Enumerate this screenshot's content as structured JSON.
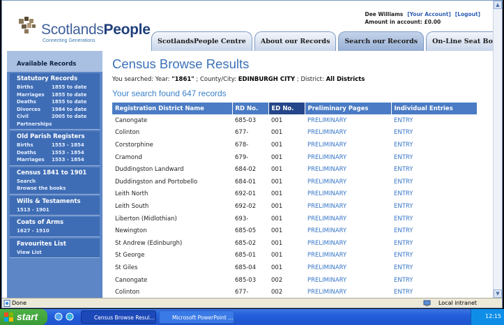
{
  "header": {
    "logo_word_regular": "Scotlands",
    "logo_word_bold": "People",
    "logo_tagline": "Connecting Generations",
    "user_name": "Dee Williams",
    "your_account_link": "[Your Account]",
    "logout_link": "[Logout]",
    "account_amount": "Amount in account: £0.00",
    "tabs": [
      {
        "label": "ScotlandsPeople Centre"
      },
      {
        "label": "About our Records"
      },
      {
        "label": "Search our Records"
      },
      {
        "label": "On-Line Seat Booking"
      }
    ]
  },
  "sidebar": {
    "available_records": "Available Records",
    "statutory": {
      "heading": "Statutory Records",
      "rows": [
        {
          "label": "Births",
          "years": "1855 to date"
        },
        {
          "label": "Marriages",
          "years": "1855 to date"
        },
        {
          "label": "Deaths",
          "years": "1855 to date"
        },
        {
          "label": "Divorces",
          "years": "1984 to date"
        },
        {
          "label": "Civil",
          "years": "2005 to date"
        }
      ],
      "partnerships": "Partnerships"
    },
    "opr": {
      "heading": "Old Parish Registers",
      "rows": [
        {
          "label": "Births",
          "years": "1553 - 1854"
        },
        {
          "label": "Deaths",
          "years": "1553 - 1854"
        },
        {
          "label": "Marriages",
          "years": "1553 - 1854"
        }
      ]
    },
    "census": {
      "heading": "Census 1841 to 1901",
      "search": "Search",
      "browse": "Browse the books"
    },
    "wills": {
      "heading": "Wills & Testaments",
      "years": "1513 - 1901"
    },
    "arms": {
      "heading": "Coats of Arms",
      "years": "1627 - 1910"
    },
    "favourites": {
      "heading": "Favourites List",
      "view": "View List"
    }
  },
  "main": {
    "title": "Census Browse Results",
    "searched_prefix": "You searched: Year:",
    "searched_year": "\"1861\"",
    "searched_county_label": "; County/City:",
    "searched_county": "EDINBURGH CITY",
    "searched_district_label": "; District:",
    "searched_district": "All Districts",
    "found": "Your search found 647 records",
    "columns": [
      "Registration District Name",
      "RD No.",
      "ED No.",
      "Preliminary Pages",
      "Individual Entries"
    ],
    "rows": [
      {
        "name": "Canongate",
        "rd": "685-03",
        "ed": "001",
        "pre": "PRELIMINARY",
        "entry": "ENTRY"
      },
      {
        "name": "Colinton",
        "rd": "677-",
        "ed": "001",
        "pre": "PRELIMINARY",
        "entry": "ENTRY"
      },
      {
        "name": "Corstorphine",
        "rd": "678-",
        "ed": "001",
        "pre": "PRELIMINARY",
        "entry": "ENTRY"
      },
      {
        "name": "Cramond",
        "rd": "679-",
        "ed": "001",
        "pre": "PRELIMINARY",
        "entry": "ENTRY"
      },
      {
        "name": "Duddingston Landward",
        "rd": "684-02",
        "ed": "001",
        "pre": "PRELIMINARY",
        "entry": "ENTRY"
      },
      {
        "name": "Duddingston and Portobello",
        "rd": "684-01",
        "ed": "001",
        "pre": "PRELIMINARY",
        "entry": "ENTRY"
      },
      {
        "name": "Leith North",
        "rd": "692-01",
        "ed": "001",
        "pre": "PRELIMINARY",
        "entry": "ENTRY"
      },
      {
        "name": "Leith South",
        "rd": "692-02",
        "ed": "001",
        "pre": "PRELIMINARY",
        "entry": "ENTRY"
      },
      {
        "name": "Liberton (Midlothian)",
        "rd": "693-",
        "ed": "001",
        "pre": "PRELIMINARY",
        "entry": "ENTRY"
      },
      {
        "name": "Newington",
        "rd": "685-05",
        "ed": "001",
        "pre": "PRELIMINARY",
        "entry": "ENTRY"
      },
      {
        "name": "St Andrew (Edinburgh)",
        "rd": "685-02",
        "ed": "001",
        "pre": "PRELIMINARY",
        "entry": "ENTRY"
      },
      {
        "name": "St George",
        "rd": "685-01",
        "ed": "001",
        "pre": "PRELIMINARY",
        "entry": "ENTRY"
      },
      {
        "name": "St Giles",
        "rd": "685-04",
        "ed": "001",
        "pre": "PRELIMINARY",
        "entry": "ENTRY"
      },
      {
        "name": "Canongate",
        "rd": "685-03",
        "ed": "002",
        "pre": "PRELIMINARY",
        "entry": "ENTRY"
      },
      {
        "name": "Colinton",
        "rd": "677-",
        "ed": "002",
        "pre": "PRELIMINARY",
        "entry": "ENTRY"
      }
    ]
  },
  "status": {
    "done": "Done",
    "zone": "Local intranet"
  },
  "taskbar": {
    "start": "start",
    "task1": "Census Browse Resul...",
    "task2": "Microsoft PowerPoint ...",
    "clock": "12:15"
  },
  "icons": {
    "logo": "thistle-logo-icon",
    "scroll_up": "scroll-up-arrow-icon",
    "scroll_down": "scroll-down-arrow-icon",
    "ie_page": "ie-page-icon",
    "zone": "local-intranet-icon"
  },
  "colors": {
    "nav_blue": "#3f6db5",
    "header_row": "#4a7bc4",
    "title_blue": "#3a71b7",
    "link_blue": "#3776c8"
  }
}
